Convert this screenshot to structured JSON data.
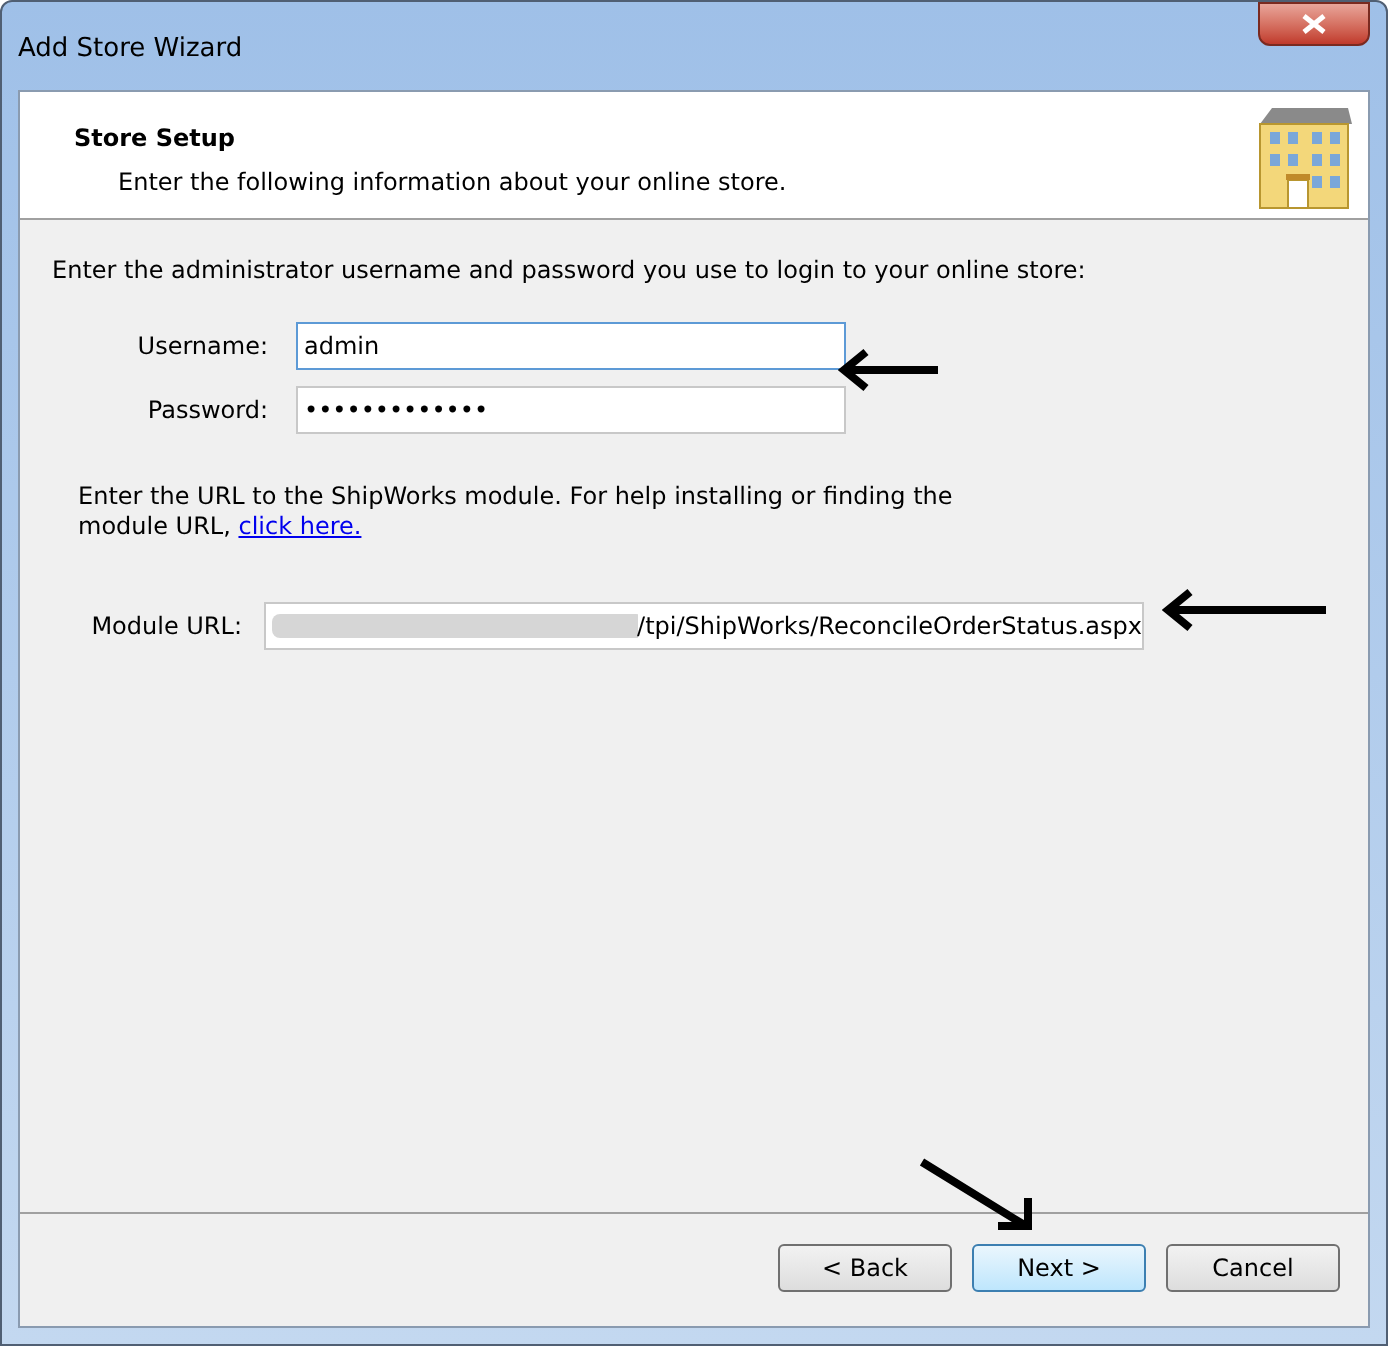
{
  "window": {
    "title": "Add Store Wizard"
  },
  "header": {
    "title": "Store Setup",
    "subtitle": "Enter the following information about your online store."
  },
  "login": {
    "instructions": "Enter the administrator username and password you use to login to your online store:",
    "fields": [
      {
        "label": "Username:",
        "value": "admin",
        "focused": true
      },
      {
        "label": "Password:",
        "value": "•••••••••••••",
        "focused": false
      }
    ]
  },
  "module": {
    "instructions": "Enter the URL to the ShipWorks module.  For help installing or finding the module URL,",
    "link": "click here.",
    "label": "Module URL:",
    "value": "/tpi/ShipWorks/ReconcileOrderStatus.aspx"
  },
  "buttons": [
    {
      "label": "< Back",
      "default": false
    },
    {
      "label": "Next >",
      "default": true
    },
    {
      "label": "Cancel",
      "default": false
    }
  ]
}
